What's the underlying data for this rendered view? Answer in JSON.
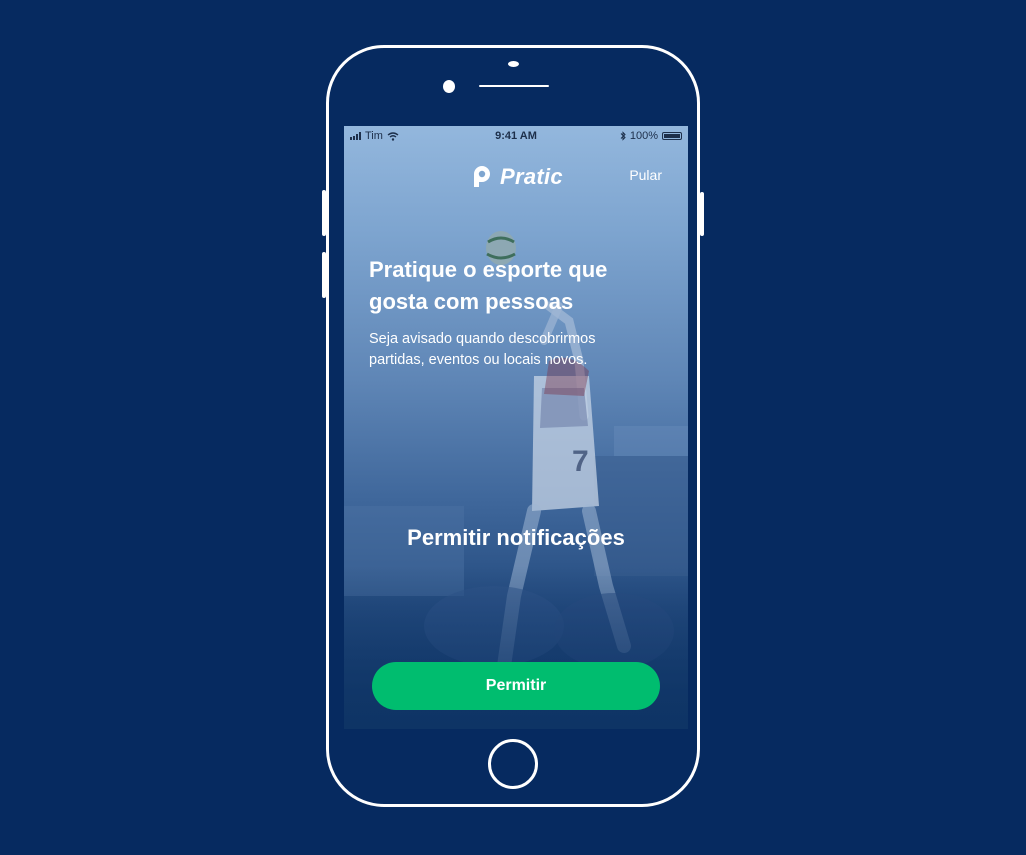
{
  "status_bar": {
    "carrier": "Tim",
    "time": "9:41 AM",
    "battery": "100%"
  },
  "header": {
    "logo_text": "Pratic",
    "skip_label": "Pular"
  },
  "content": {
    "headline_line1": "Pratique o esporte que",
    "headline_line2": "gosta com pessoas",
    "subline_line1": "Seja avisado quando descobrirmos",
    "subline_line2": "partidas, eventos ou locais novos.",
    "cta_title": "Permitir notificações"
  },
  "actions": {
    "allow_label": "Permitir"
  },
  "colors": {
    "background": "#062a60",
    "accent": "#00bd6f"
  },
  "icons": [
    "signal-icon",
    "wifi-icon",
    "bluetooth-icon",
    "battery-icon",
    "pratic-logo-icon"
  ]
}
